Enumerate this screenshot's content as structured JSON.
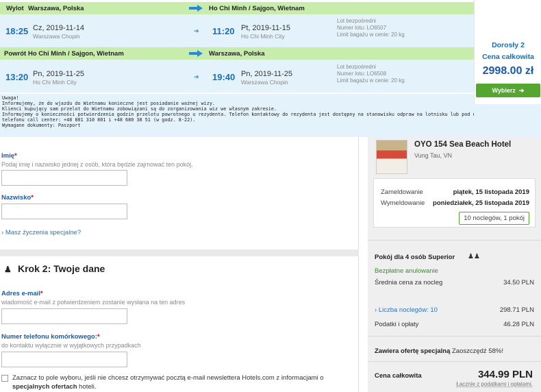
{
  "flight": {
    "outbound": {
      "label": "Wylot",
      "from": "Warszawa, Polska",
      "to": "Ho Chi Minh / Sajgon, Wietnam",
      "dep_time": "18:25",
      "dep_date": "Cz, 2019-11-14",
      "dep_city": "Warszawa Chopin",
      "arr_time": "11:20",
      "arr_date": "Pt, 2019-11-15",
      "arr_city": "Ho Chi Minh City",
      "info1": "Lot bezpośredni",
      "info2": "Numer lotu: LO6507",
      "info3": "Limit bagażu w cenie: 20 kg"
    },
    "return": {
      "label": "Powrót",
      "from": "Ho Chi Minh / Sajgon, Wietnam",
      "to": "Warszawa, Polska",
      "dep_time": "13:20",
      "dep_date": "Pn, 2019-11-25",
      "dep_city": "Ho Chi Minh City",
      "arr_time": "19:40",
      "arr_date": "Pn, 2019-11-25",
      "arr_city": "Warszawa Chopin",
      "info1": "Lot bezpośredni",
      "info2": "Numer lotu: LO6508",
      "info3": "Limit bagażu w cenie: 20 kg"
    },
    "price": {
      "adults": "Dorosły 2",
      "total_label": "Cena całkowita",
      "amount": "2998.00 zł",
      "choose_label": "Wybierz"
    },
    "notice": [
      "Uwaga!",
      "Informujemy, że do wjazdu do Wietnamu konieczne jest posiadanie ważnej wizy.",
      "Klienci kupujący sam przelot do Wietnamu zobowiązani są do zorganizowania wiz we własnym zakresie.",
      "Informujemy o konieczności potwierdzenia godzin przelotu powrotnego u rezydenta. Telefon kontaktowy do rezydenta jest dostępny na stanowisku odpraw na lotnisku lub pod nr",
      "telefonu call center: +48 801 310 801 i +48 680 38 51 (w godz. 8-22).",
      " Wymagane dokumenty: Paszport"
    ]
  },
  "form": {
    "first_name": {
      "label": "Imię",
      "hint": "Podaj imię i nazwisko jednej z osób, która będzie zajmować ten pokój.",
      "value": ""
    },
    "last_name": {
      "label": "Nazwisko",
      "value": ""
    },
    "special_requests": "Masz życzenia specjalne?",
    "step2_title": "Krok 2: Twoje dane",
    "email": {
      "label": "Adres e-mail",
      "hint": "wiadomość e-mail z potwierdzeniem zostanie wysłana na ten adres",
      "value": ""
    },
    "phone": {
      "label": "Numer telefonu komórkowego:",
      "hint": "do kontaktu wyłącznie w wyjątkowych przypadkach",
      "value": ""
    },
    "newsletter_text": "Zaznacz to pole wyboru, jeśli nie chcesz otrzymywać pocztą e-mail newslettera Hotels.com z informacjami o",
    "newsletter_bold": "specjalnych ofertach",
    "newsletter_tail": " hoteli."
  },
  "hotel": {
    "name": "OYO 154 Sea Beach Hotel",
    "location": "Vung Tau, VN",
    "checkin_label": "Zameldowanie",
    "checkin_value": "piątek, 15 listopada 2019",
    "checkout_label": "Wymeldowanie",
    "checkout_value": "poniedziałek, 25 listopada 2019",
    "nights_badge": "10 noclegów, 1 pokój",
    "room_name": "Pokój dla 4 osób Superior",
    "free_cancel": "Bezpłatne anulowanie",
    "avg_label": "Średnia cena za nocleg",
    "avg_value": "34.50 PLN",
    "nights_label": "Liczba noclegów: 10",
    "nights_value": "298.71 PLN",
    "taxes_label": "Podatki i opłaty",
    "taxes_value": "46.28 PLN",
    "offer_bold": "Zawiera ofertę specjalną",
    "offer_text": " Zaoszczędź 58%!",
    "total_label": "Cena całkowita",
    "total_value": "344.99 PLN",
    "total_sub": "Łącznie z podatkami i opłatami."
  }
}
